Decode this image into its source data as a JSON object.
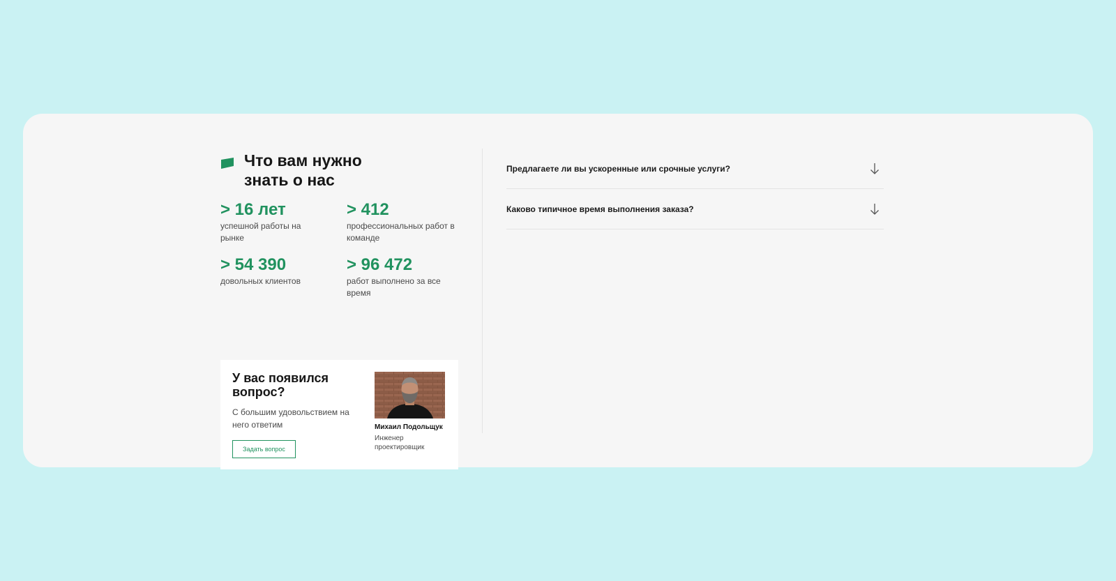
{
  "section": {
    "title": "Что вам нужно знать о нас"
  },
  "stats": [
    {
      "value": "> 16 лет",
      "desc": "успешной работы на рынке"
    },
    {
      "value": "> 412",
      "desc": "профессиональных работ в команде"
    },
    {
      "value": "> 54 390",
      "desc": "довольных клиентов"
    },
    {
      "value": "> 96 472",
      "desc": "работ выполнено за все время"
    }
  ],
  "contact": {
    "title": "У вас появился вопрос?",
    "text": "С большим удовольствием на него ответим",
    "button_label": "Задать вопрос",
    "person_name": "Михаил Подольщук",
    "person_role": "Инженер проектировщик"
  },
  "faq": [
    {
      "question": "Предлагаете ли вы ускоренные или срочные услуги?",
      "icon": "arrow-down-icon"
    },
    {
      "question": "Каково типичное время выполнения заказа?",
      "icon": "arrow-down-icon"
    }
  ],
  "colors": {
    "background": "#caf2f3",
    "card": "#f6f6f6",
    "accent": "#21925f",
    "text": "#1a1a1a"
  }
}
